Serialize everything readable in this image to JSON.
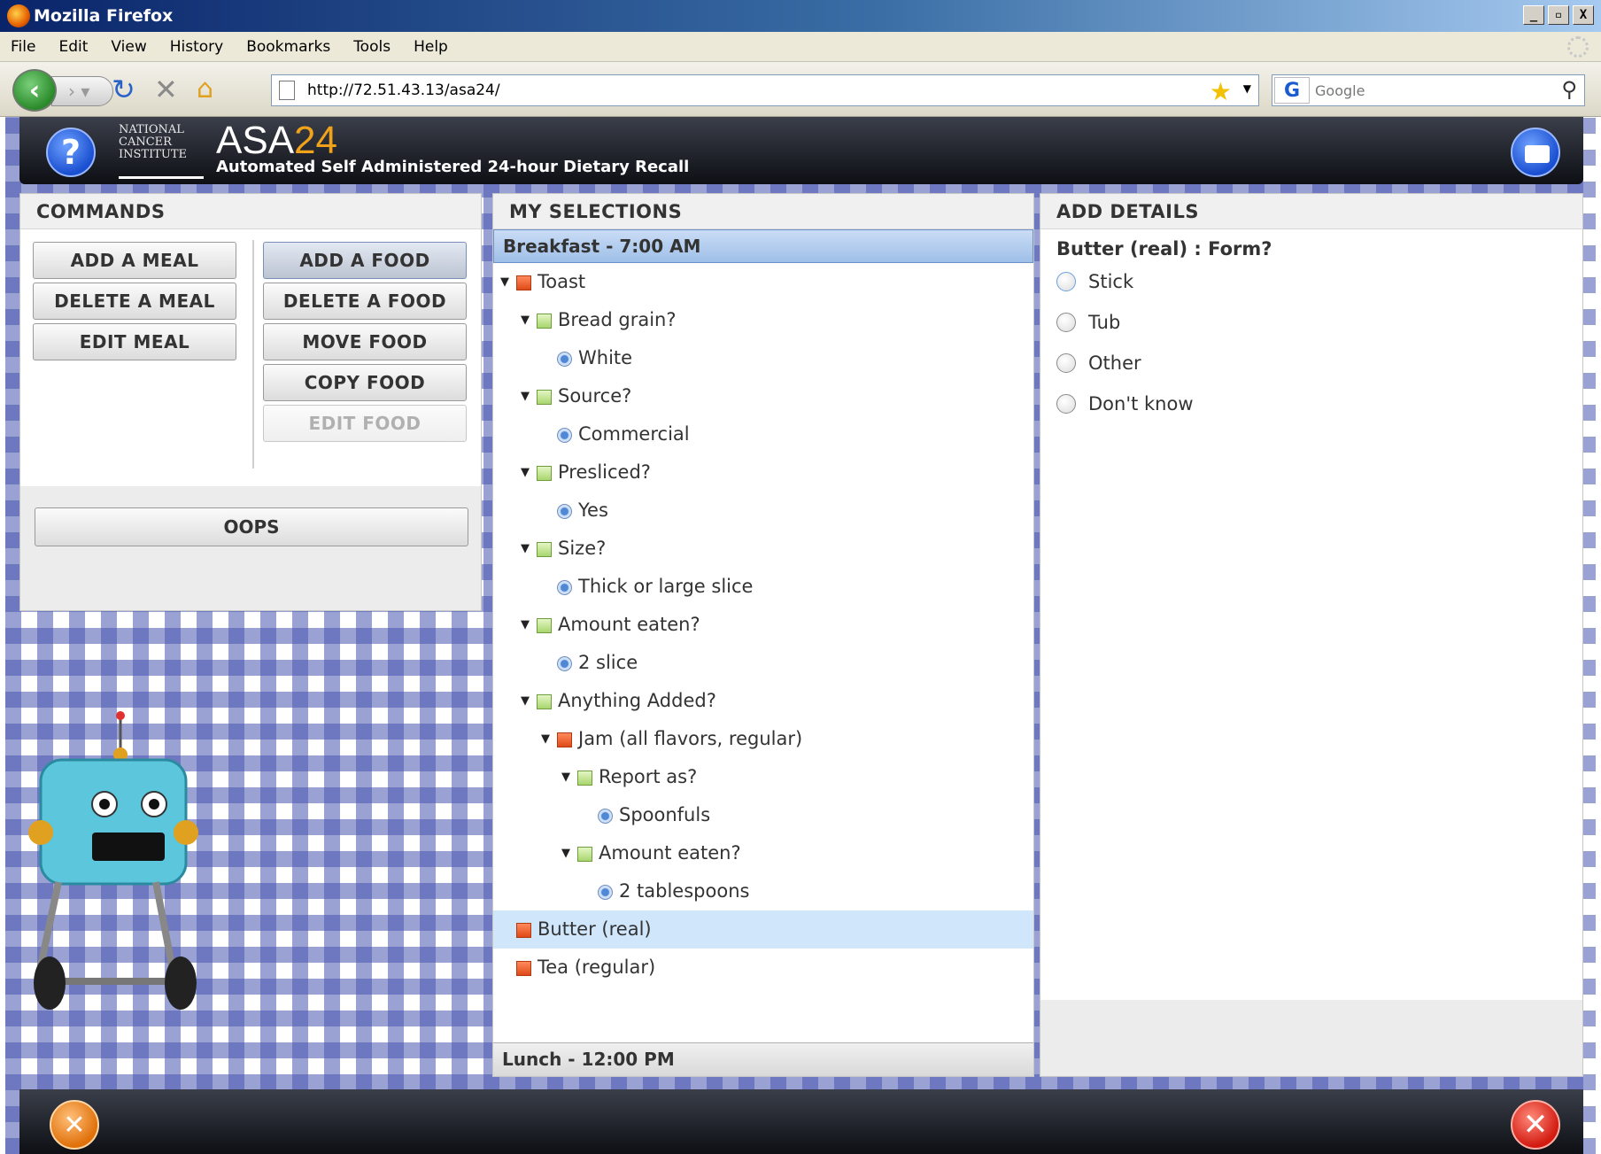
{
  "window": {
    "title": "Mozilla Firefox",
    "controls": [
      "_",
      "▫",
      "X"
    ]
  },
  "menu": [
    "File",
    "Edit",
    "View",
    "History",
    "Bookmarks",
    "Tools",
    "Help"
  ],
  "navbar": {
    "url": "http://72.51.43.13/asa24/",
    "search_placeholder": "Google",
    "search_engine": "G"
  },
  "app": {
    "title_prefix": "ASA",
    "title_num": "24",
    "subtitle": "Automated Self Administered 24-hour Dietary Recall",
    "nci_logo_lines": [
      "NATIONAL",
      "CANCER",
      "INSTITUTE"
    ]
  },
  "commands": {
    "header": "COMMANDS",
    "left": [
      "ADD A MEAL",
      "DELETE A MEAL",
      "EDIT MEAL"
    ],
    "right": [
      "ADD A FOOD",
      "DELETE A FOOD",
      "MOVE FOOD",
      "COPY FOOD",
      "EDIT FOOD"
    ],
    "oops": "OOPS"
  },
  "selections": {
    "header": "MY SELECTIONS",
    "meal1": "Breakfast - 7:00 AM",
    "meal2": "Lunch - 12:00 PM",
    "items": [
      {
        "text": "Toast",
        "type": "food",
        "depth": 0,
        "expand": true
      },
      {
        "text": "Bread grain?",
        "type": "question",
        "depth": 1,
        "expand": true
      },
      {
        "text": "White",
        "type": "answer",
        "depth": 2
      },
      {
        "text": "Source?",
        "type": "question",
        "depth": 1,
        "expand": true
      },
      {
        "text": "Commercial",
        "type": "answer",
        "depth": 2
      },
      {
        "text": "Presliced?",
        "type": "question",
        "depth": 1,
        "expand": true
      },
      {
        "text": "Yes",
        "type": "answer",
        "depth": 2
      },
      {
        "text": "Size?",
        "type": "question",
        "depth": 1,
        "expand": true
      },
      {
        "text": "Thick or large slice",
        "type": "answer",
        "depth": 2
      },
      {
        "text": "Amount eaten?",
        "type": "question",
        "depth": 1,
        "expand": true
      },
      {
        "text": "2 slice",
        "type": "answer",
        "depth": 2
      },
      {
        "text": "Anything Added?",
        "type": "question",
        "depth": 1,
        "expand": true
      },
      {
        "text": "Jam (all flavors, regular)",
        "type": "food",
        "depth": 2,
        "expand": true
      },
      {
        "text": "Report as?",
        "type": "question",
        "depth": 3,
        "expand": true
      },
      {
        "text": "Spoonfuls",
        "type": "answer",
        "depth": 4
      },
      {
        "text": "Amount eaten?",
        "type": "question",
        "depth": 3,
        "expand": true
      },
      {
        "text": "2 tablespoons",
        "type": "answer",
        "depth": 4
      },
      {
        "text": "Butter (real)",
        "type": "food",
        "depth": 0,
        "selected": true
      },
      {
        "text": "Tea (regular)",
        "type": "food",
        "depth": 0
      }
    ]
  },
  "details": {
    "header": "ADD DETAILS",
    "question": "Butter (real) : Form?",
    "options": [
      "Stick",
      "Tub",
      "Other",
      "Don't know"
    ]
  },
  "colors": {
    "accent": "#f0a21b",
    "selected_row": "#cfe6fb",
    "gingham": "#4856b0"
  }
}
